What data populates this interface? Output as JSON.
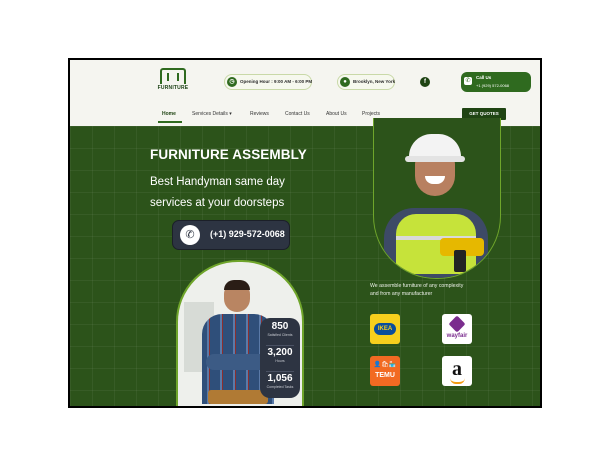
{
  "header": {
    "logo_text": "FURNITURE",
    "hours": "Opening Hour : 9:00 AM - 6:00 PM",
    "location": "Brooklyn, New York",
    "facebook": "f",
    "call_title": "Call Us",
    "call_number": "+1 (929) 572-0068"
  },
  "nav": {
    "items": [
      "Home",
      "Services Details",
      "Reviews",
      "Contact Us",
      "About Us",
      "Projects"
    ],
    "active": "Home",
    "services_caret": "▾",
    "cta": "GET QUOTES"
  },
  "hero": {
    "title": "FURNITURE ASSEMBLY",
    "subtitle_line1": "Best Handyman same day",
    "subtitle_line2": "services at your doorsteps",
    "phone": "(+1) 929-572-0068"
  },
  "stats": [
    {
      "value": "850",
      "label": "Satisfied Clients"
    },
    {
      "value": "3,200",
      "label": "Hours"
    },
    {
      "value": "1,056",
      "label": "Completed Tasks"
    }
  ],
  "brands": {
    "intro_line1": "We assemble furniture of any complexity",
    "intro_line2": "and from any manufacturer",
    "ikea": "IKEA",
    "wayfair": "wayfair",
    "temu_icons": "👤🛍🏪",
    "temu": "TEMU",
    "amazon": "a"
  },
  "icons": {
    "clock": "clock-icon",
    "pin": "map-pin-icon",
    "phone": "phone-icon",
    "facebook": "facebook-icon"
  },
  "colors": {
    "brand_green": "#2c531a",
    "accent_green": "#6fa52b",
    "dark_button": "#2d3442"
  }
}
